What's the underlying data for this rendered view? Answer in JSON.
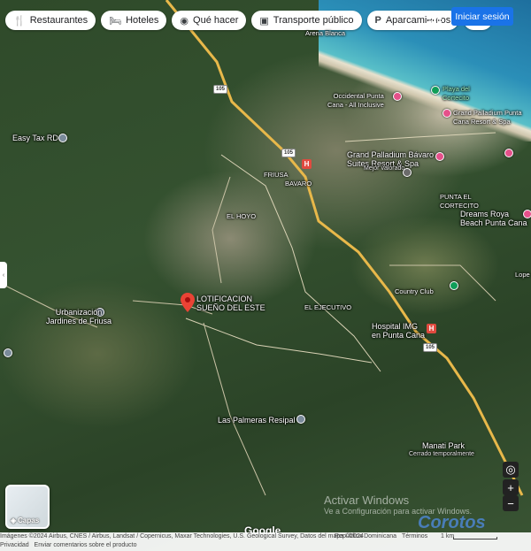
{
  "toolbar": {
    "chips": [
      {
        "label": "Restaurantes",
        "icon": "fork-knife-icon"
      },
      {
        "label": "Hoteles",
        "icon": "bed-icon"
      },
      {
        "label": "Qué hacer",
        "icon": "camera-icon"
      },
      {
        "label": "Transporte público",
        "icon": "bus-icon"
      },
      {
        "label": "Aparcamientos",
        "icon": "parking-icon"
      }
    ],
    "more": "›",
    "signin": "Iniciar sesión"
  },
  "places": {
    "main": "LOTIFICACION\nSUEÑO DEL ESTE",
    "arena_blanca": "Arena Blanca",
    "playa_cortecito": "Playa del\nCortecito",
    "occidental": "Occidental Punta\nCana - All Inclusive",
    "grand_palladium_pc": "Grand Palladium Punta\nCana Resort & Spa",
    "easy_tax": "Easy Tax RD",
    "grand_palladium_bavaro": "Grand Palladium Bávaro\nSuites Resort & Spa",
    "bavaro_rating": "Mejor valorado",
    "friusa": "FRIUSA",
    "bavaro": "BAVARO",
    "punta_cortecito": "PUNTA EL\nCORTECITO",
    "dreams_royal": "Dreams Roya\nBeach Punta Cana",
    "el_hoyo": "EL HOYO",
    "country_club": "Country Club",
    "urbanizacion": "Urbanización\nJardines de Friusa",
    "el_ejecutivo": "EL EJECUTIVO",
    "hospital": "Hospital IMG\nen Punta Cana",
    "las_palmeras": "Las Palmeras Resipal",
    "manati": "Manati Park",
    "manati_status": "Cerrado temporalmente",
    "lopez": "Lope"
  },
  "roads": {
    "r105a": "105",
    "r105b": "105",
    "r105c": "105"
  },
  "controls": {
    "layers": "Capas",
    "zoom_in": "+",
    "zoom_out": "−",
    "locate": "◎",
    "left_tab": "‹"
  },
  "branding": {
    "google": "Google",
    "wm_line1": "Activar Windows",
    "wm_line2": "Ve a Configuración para activar Windows.",
    "corotos": "Corotos"
  },
  "attribution": {
    "imagery": "Imágenes ©2024 Airbus, CNES / Airbus, Landsat / Copernicus, Maxar Technologies, U.S. Geological Survey, Datos del mapa ©2024",
    "privacy": "Privacidad",
    "feedback": "Enviar comentarios sobre el producto",
    "country": "República Dominicana",
    "terms": "Términos",
    "scale": "1 km"
  }
}
